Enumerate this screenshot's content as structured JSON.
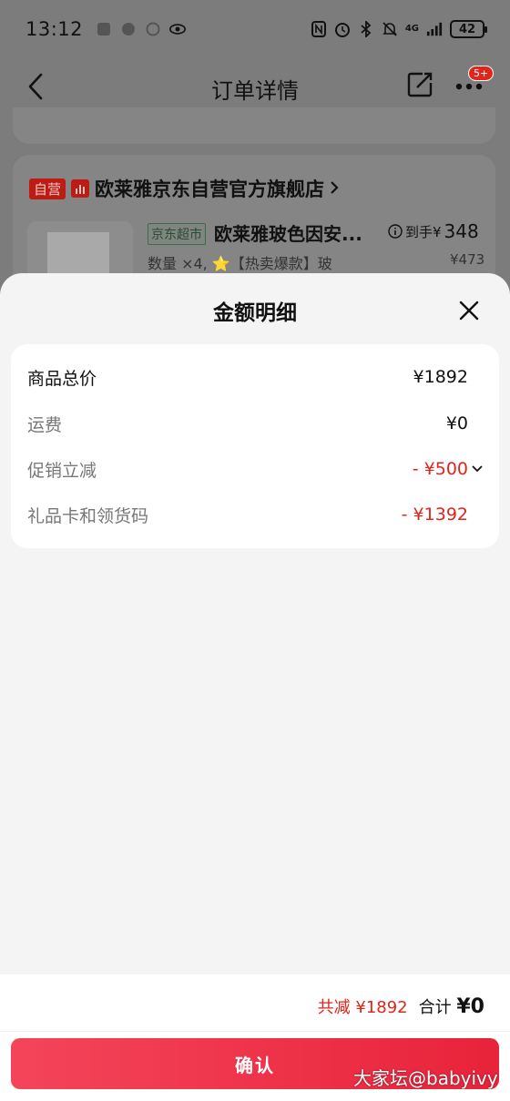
{
  "status_bar": {
    "time": "13:12",
    "network": "4G",
    "battery": "42"
  },
  "header": {
    "title": "订单详情",
    "badge": "5+"
  },
  "order": {
    "self_tag": "自营",
    "shop_name": "欧莱雅京东自营官方旗舰店",
    "market_tag": "京东超市",
    "product_name": "欧莱雅玻色因安...",
    "in_hand_label": "到手¥",
    "in_hand_price": "348",
    "quantity_line": "数量 ×4, ⭐【热卖爆款】玻",
    "original_price": "¥473"
  },
  "sheet": {
    "title": "金额明细",
    "rows": [
      {
        "label": "商品总价",
        "value": "¥1892"
      },
      {
        "label": "运费",
        "value": "¥0"
      },
      {
        "label": "促销立减",
        "value": "- ¥500"
      },
      {
        "label": "礼品卡和领货码",
        "value": "- ¥1392"
      }
    ]
  },
  "footer": {
    "reduction": "共减 ¥1892",
    "total_label": "合计 ",
    "total_value": "¥0",
    "confirm_label": "确认"
  },
  "watermark": "大家坛@babyivy",
  "colors": {
    "accent_red": "#e1251b",
    "button_gradient_start": "#f4455a",
    "button_gradient_end": "#e8233a"
  }
}
